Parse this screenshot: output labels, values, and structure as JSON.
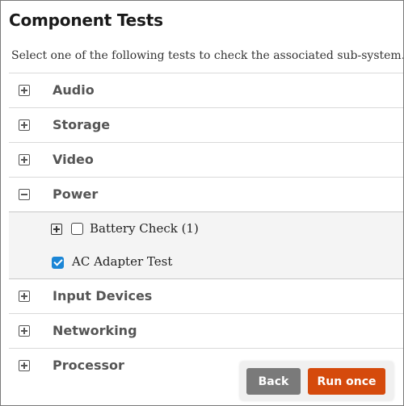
{
  "page": {
    "title": "Component Tests",
    "subtitle": "Select one of the following tests to check the associated sub-system."
  },
  "categories": [
    {
      "label": "Audio",
      "state": "collapsed"
    },
    {
      "label": "Storage",
      "state": "collapsed"
    },
    {
      "label": "Video",
      "state": "collapsed"
    },
    {
      "label": "Power",
      "state": "expanded"
    },
    {
      "label": "Input Devices",
      "state": "collapsed"
    },
    {
      "label": "Networking",
      "state": "collapsed"
    },
    {
      "label": "Processor",
      "state": "collapsed"
    }
  ],
  "power_tests": [
    {
      "label": "Battery Check (1)",
      "checked": false,
      "expandable": true
    },
    {
      "label": "AC Adapter Test",
      "checked": true,
      "expandable": false
    }
  ],
  "buttons": {
    "back": "Back",
    "run": "Run once"
  },
  "colors": {
    "run_button": "#d54a0c",
    "back_button": "#7a7a7a",
    "checkbox_checked": "#1b86d6"
  },
  "icons": {
    "collapsed": "plus-box-icon",
    "expanded": "minus-box-icon"
  }
}
